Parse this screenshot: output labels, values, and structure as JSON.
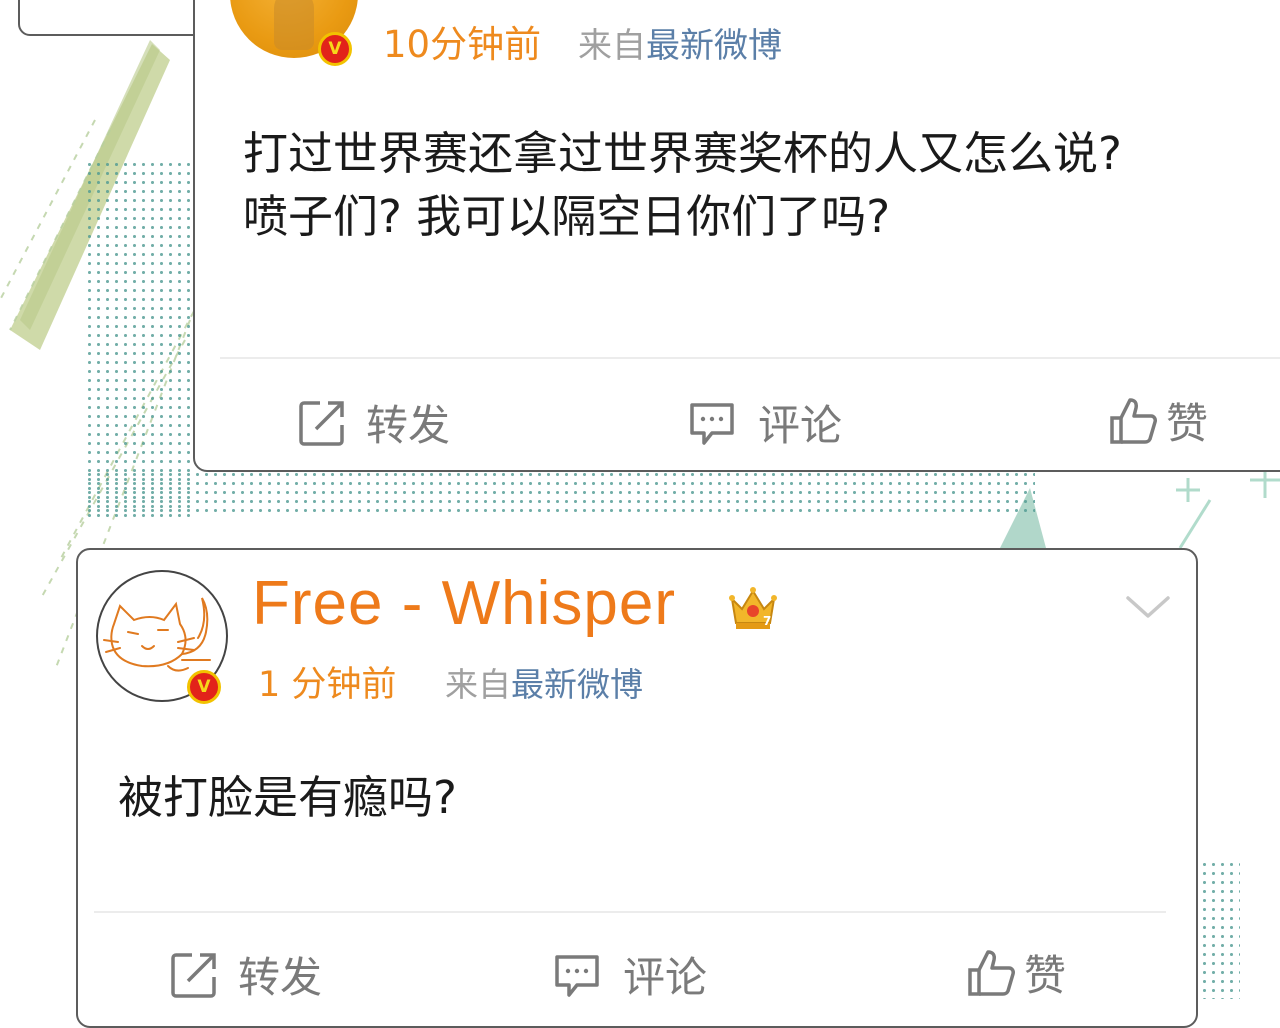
{
  "post1": {
    "time": "10分钟前",
    "from_label": "来自",
    "source": "最新微博",
    "verified_icon": "V",
    "text_line1": "打过世界赛还拿过世界赛奖杯的人又怎么说?",
    "text_line2": "喷子们? 我可以隔空日你们了吗?",
    "actions": {
      "repost": "转发",
      "comment": "评论",
      "like": "赞"
    }
  },
  "post2": {
    "username": "Free - Whisper",
    "time": "1 分钟前",
    "from_label": "来自",
    "source": "最新微博",
    "verified_icon": "V",
    "crown_level": "7",
    "text": "被打脸是有瘾吗?",
    "actions": {
      "repost": "转发",
      "comment": "评论",
      "like": "赞"
    }
  },
  "colors": {
    "accent_orange": "#ee8a1e",
    "source_blue": "#5b7fa8",
    "dots_teal": "#4f9a92",
    "shard_green": "#c7d49a",
    "verified_red": "#e2231a"
  },
  "icons": [
    "repost-icon",
    "comment-icon",
    "like-icon",
    "crown-icon",
    "chevron-down-icon",
    "verified-badge-icon",
    "cat-avatar"
  ]
}
